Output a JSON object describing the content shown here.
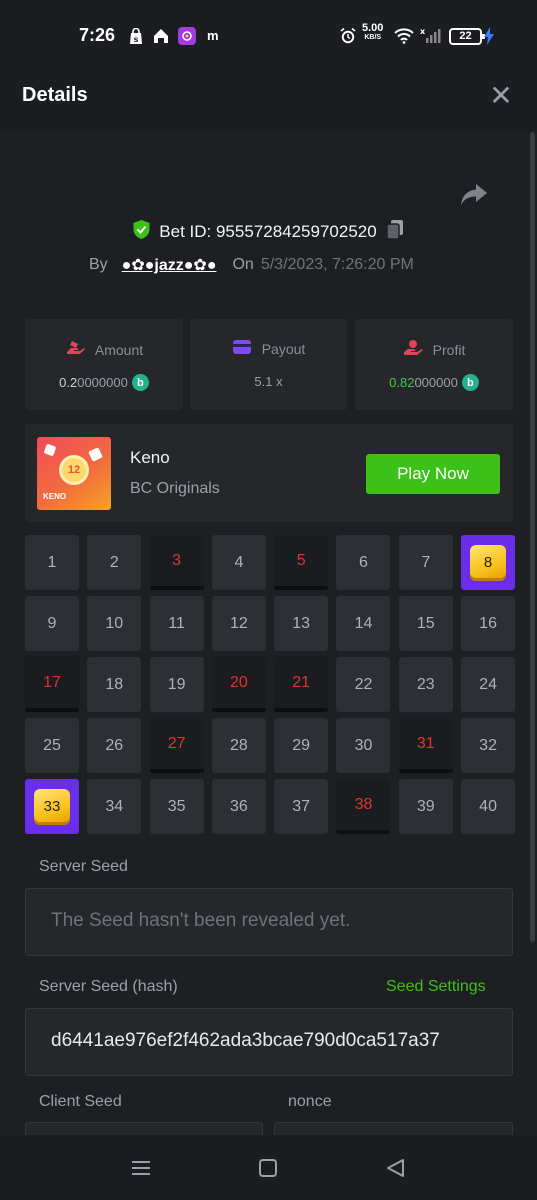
{
  "status_bar": {
    "time": "7:26",
    "notif_m": "m",
    "speed_value": "5.00",
    "speed_unit": "KB/S",
    "signal_x": "x",
    "battery": "22"
  },
  "header": {
    "title": "Details",
    "close_symbol": "✕"
  },
  "bet": {
    "bet_id_text": "Bet ID: 95557284259702520",
    "by_label": "By",
    "user": "●✿●jazz●✿●",
    "on_label": "On",
    "date": "5/3/2023, 7:26:20 PM"
  },
  "stats": {
    "amount": {
      "label": "Amount",
      "value_main": "0.2",
      "value_rest": "0000000",
      "coin": "b"
    },
    "payout": {
      "label": "Payout",
      "value": "5.1 x"
    },
    "profit": {
      "label": "Profit",
      "value_main": "0.82",
      "value_rest": "000000",
      "coin": "b"
    }
  },
  "game": {
    "thumb_number": "12",
    "thumb_label": "KENO",
    "name": "Keno",
    "provider": "BC Originals",
    "play_label": "Play Now"
  },
  "keno": {
    "tiles": [
      {
        "n": "1",
        "s": "none"
      },
      {
        "n": "2",
        "s": "none"
      },
      {
        "n": "3",
        "s": "hit"
      },
      {
        "n": "4",
        "s": "none"
      },
      {
        "n": "5",
        "s": "hit"
      },
      {
        "n": "6",
        "s": "none"
      },
      {
        "n": "7",
        "s": "none"
      },
      {
        "n": "8",
        "s": "win"
      },
      {
        "n": "9",
        "s": "none"
      },
      {
        "n": "10",
        "s": "none"
      },
      {
        "n": "11",
        "s": "none"
      },
      {
        "n": "12",
        "s": "none"
      },
      {
        "n": "13",
        "s": "none"
      },
      {
        "n": "14",
        "s": "none"
      },
      {
        "n": "15",
        "s": "none"
      },
      {
        "n": "16",
        "s": "none"
      },
      {
        "n": "17",
        "s": "hit"
      },
      {
        "n": "18",
        "s": "none"
      },
      {
        "n": "19",
        "s": "none"
      },
      {
        "n": "20",
        "s": "hit"
      },
      {
        "n": "21",
        "s": "hit"
      },
      {
        "n": "22",
        "s": "none"
      },
      {
        "n": "23",
        "s": "none"
      },
      {
        "n": "24",
        "s": "none"
      },
      {
        "n": "25",
        "s": "none"
      },
      {
        "n": "26",
        "s": "none"
      },
      {
        "n": "27",
        "s": "hit"
      },
      {
        "n": "28",
        "s": "none"
      },
      {
        "n": "29",
        "s": "none"
      },
      {
        "n": "30",
        "s": "none"
      },
      {
        "n": "31",
        "s": "hit"
      },
      {
        "n": "32",
        "s": "none"
      },
      {
        "n": "33",
        "s": "win"
      },
      {
        "n": "34",
        "s": "none"
      },
      {
        "n": "35",
        "s": "none"
      },
      {
        "n": "36",
        "s": "none"
      },
      {
        "n": "37",
        "s": "none"
      },
      {
        "n": "38",
        "s": "hit"
      },
      {
        "n": "39",
        "s": "none"
      },
      {
        "n": "40",
        "s": "none"
      }
    ]
  },
  "seeds": {
    "server_seed_label": "Server Seed",
    "server_seed_placeholder": "The Seed hasn't been revealed yet.",
    "server_hash_label": "Server Seed (hash)",
    "seed_settings": "Seed Settings",
    "server_hash_value": "d6441ae976ef2f462ada3bcae790d0ca517a37",
    "client_seed_label": "Client Seed",
    "nonce_label": "nonce"
  },
  "colors": {
    "accent_green": "#3bc117",
    "hit_red": "#e0352f",
    "win_purple": "#6a2ee8"
  }
}
